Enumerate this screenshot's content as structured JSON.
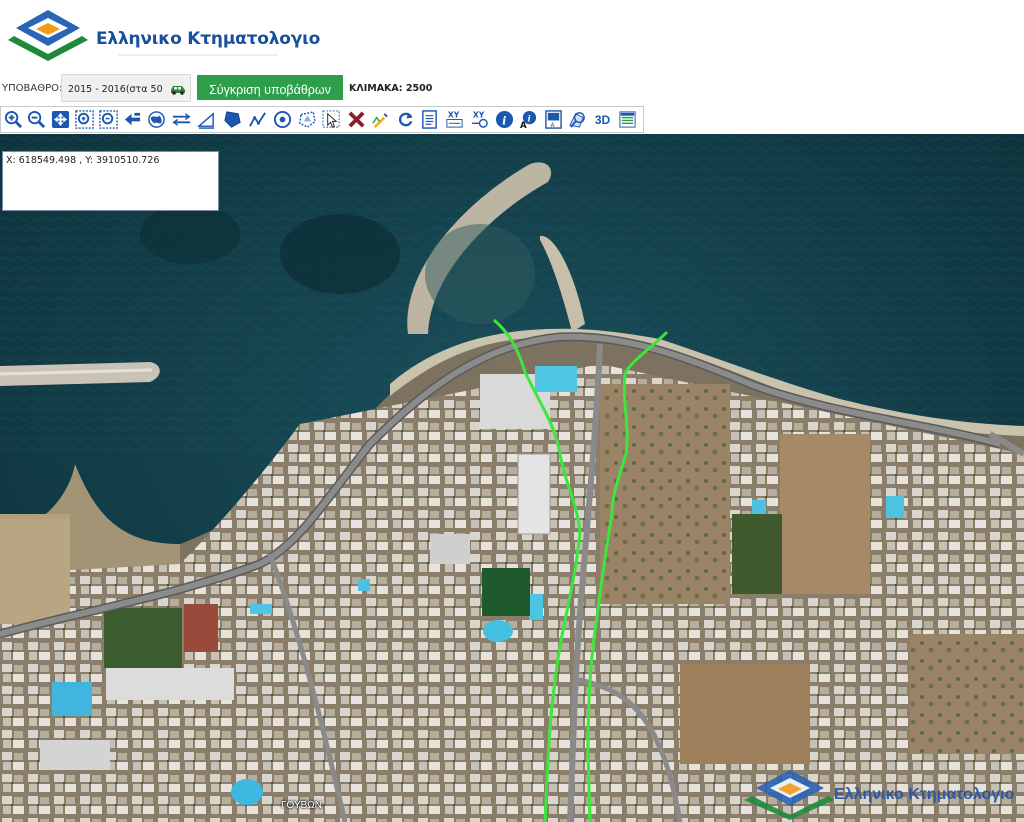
{
  "header": {
    "brand_text": "Ελληνικο Κτηματολογιο",
    "logo_icon": "ktimatologio-logo-icon"
  },
  "controls": {
    "basemap_label": "ΥΠΟΒΑΘΡΟ:",
    "basemap_value": "2015 - 2016(στα 50",
    "basemap_icon": "car-icon",
    "compare_button": "Σύγκριση υποβάθρων",
    "scale_label": "ΚΛΙΜΑΚΑ: 2500"
  },
  "toolbar": {
    "tools": [
      {
        "name": "zoom-in-icon"
      },
      {
        "name": "zoom-out-icon"
      },
      {
        "name": "pan-icon"
      },
      {
        "name": "zoom-box-in-icon"
      },
      {
        "name": "zoom-box-out-icon"
      },
      {
        "name": "previous-extent-icon"
      },
      {
        "name": "full-extent-icon"
      },
      {
        "name": "measure-distance-icon"
      },
      {
        "name": "measure-area-icon"
      },
      {
        "name": "draw-polygon-icon"
      },
      {
        "name": "draw-line-icon"
      },
      {
        "name": "draw-circle-icon"
      },
      {
        "name": "draw-freeform-icon"
      },
      {
        "name": "select-icon"
      },
      {
        "name": "delete-icon"
      },
      {
        "name": "edit-icon"
      },
      {
        "name": "refresh-icon"
      },
      {
        "name": "document-icon"
      },
      {
        "name": "xy-input-icon"
      },
      {
        "name": "xy-goto-icon"
      },
      {
        "name": "info-icon"
      },
      {
        "name": "info-annotation-icon"
      },
      {
        "name": "print-icon"
      },
      {
        "name": "search-parcel-icon"
      },
      {
        "name": "3d-view-icon",
        "text": "3D"
      },
      {
        "name": "layers-icon"
      }
    ]
  },
  "map": {
    "coordinate_readout": "X: 618549.498 , Y: 3910510.726",
    "street_label": "ΓΟΥΒΩΝ",
    "watermark_text": "Ελληνικο Κτηματολογιο",
    "line_color": "#3de63d",
    "sea_color": "#0f3640"
  }
}
